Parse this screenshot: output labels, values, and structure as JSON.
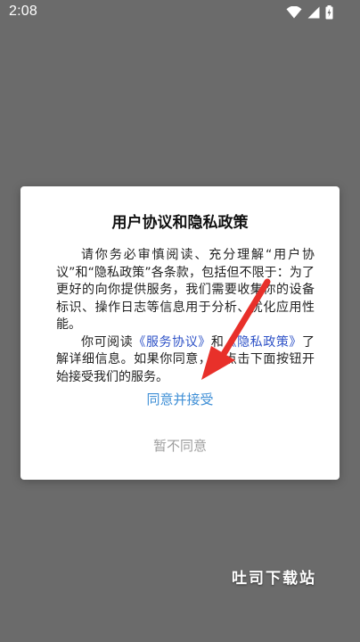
{
  "status_bar": {
    "time": "2:08",
    "icons": [
      "wifi-icon",
      "signal-icon",
      "battery-icon"
    ]
  },
  "dialog": {
    "title": "用户协议和隐私政策",
    "paragraph1": "请你务必审慎阅读、充分理解“用户协议”和“隐私政策”各条款，包括但不限于：为了更好的向你提供服务，我们需要收集你的设备标识、操作日志等信息用于分析、优化应用性能。",
    "paragraph2_prefix": "你可阅读",
    "service_agreement_link": "《服务协议》",
    "paragraph2_and": "和",
    "privacy_policy_link": "《隐私政策》",
    "paragraph2_suffix": "了解详细信息。如果你同意，请点击下面按钮开始接受我们的服务。",
    "agree_label": "同意并接受",
    "decline_label": "暂不同意"
  },
  "watermark": "吐司下载站",
  "colors": {
    "background": "#6b6b6b",
    "link": "#2e52c7",
    "agree": "#3f8fd6",
    "decline": "#9e9e9e",
    "arrow": "#e8302a"
  }
}
